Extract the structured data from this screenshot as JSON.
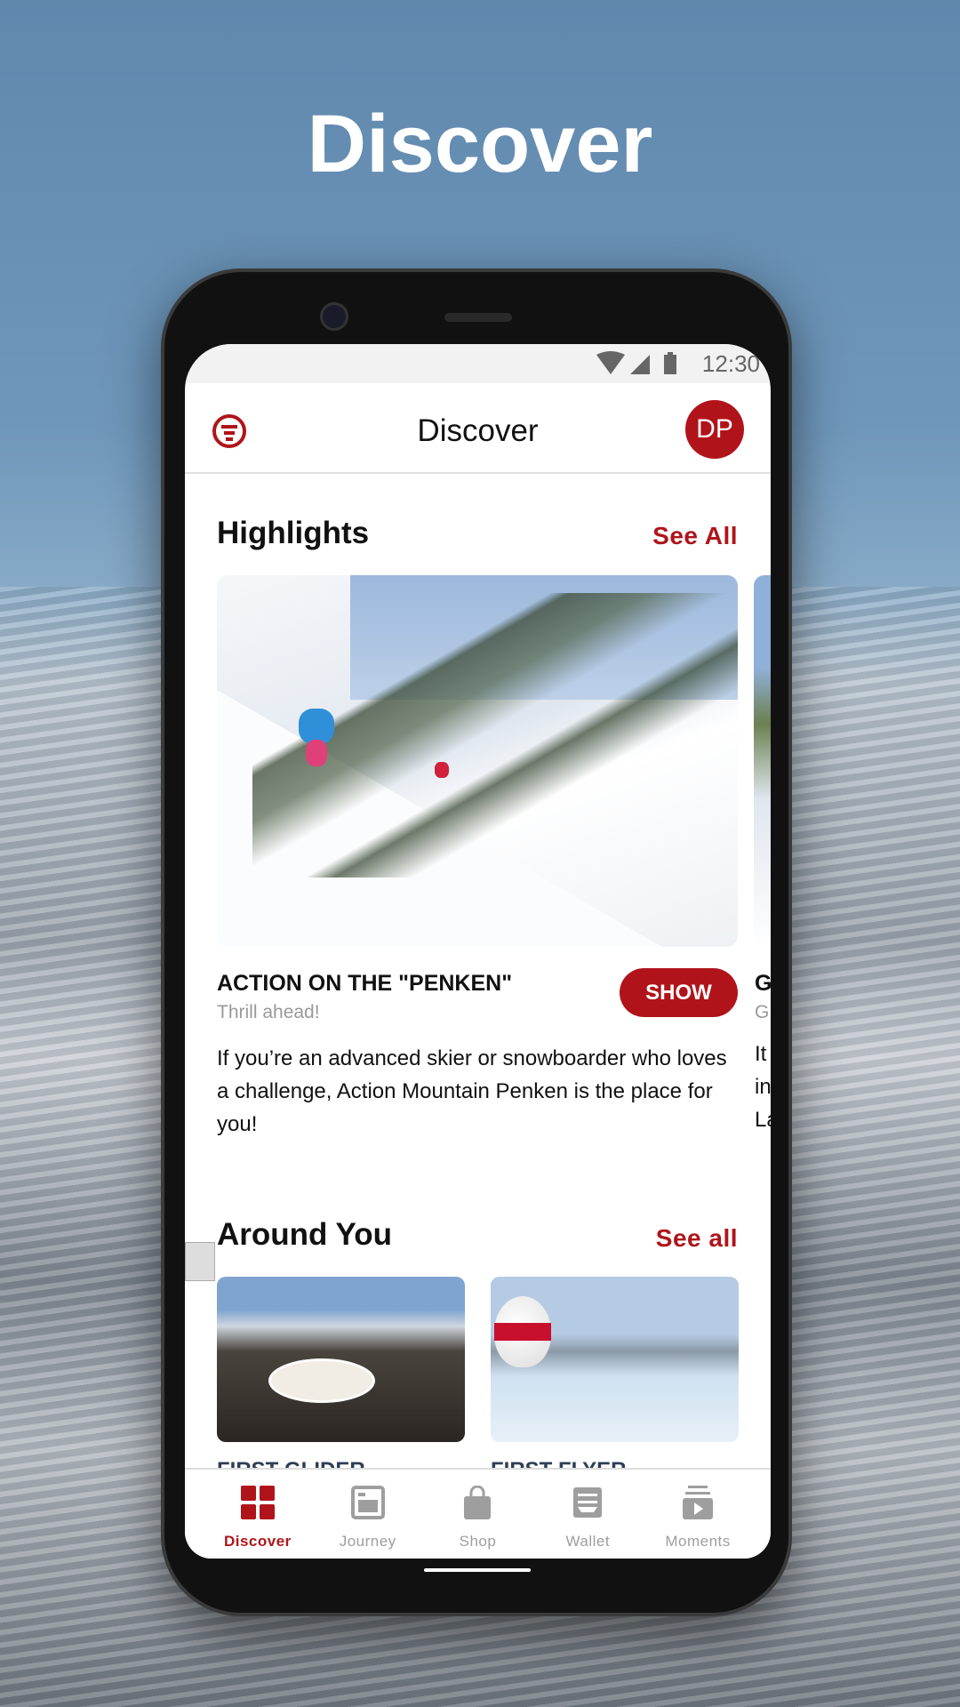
{
  "promo": {
    "title": "Discover"
  },
  "status": {
    "time": "12:30"
  },
  "appbar": {
    "title": "Discover",
    "avatar_initials": "DP"
  },
  "highlights": {
    "title": "Highlights",
    "see_all": "See All",
    "card": {
      "title": "ACTION ON THE \"PENKEN\"",
      "subtitle": "Thrill ahead!",
      "description": "If you’re an advanced skier or snowboarder who loves a challenge, Action Mountain Penken is the place for you!",
      "button": "SHOW"
    },
    "peek_card": {
      "title": "G",
      "subtitle": "G",
      "lines": [
        "It",
        "in",
        "La"
      ]
    }
  },
  "around": {
    "title": "Around You",
    "see_all": "See all",
    "items": [
      {
        "title": "FIRST GLIDER"
      },
      {
        "title": "FIRST FLYER"
      }
    ]
  },
  "nav": {
    "items": [
      {
        "label": "Discover",
        "icon": "grid-icon",
        "active": true
      },
      {
        "label": "Journey",
        "icon": "journey-icon"
      },
      {
        "label": "Shop",
        "icon": "shopping-bag-icon"
      },
      {
        "label": "Wallet",
        "icon": "wallet-icon"
      },
      {
        "label": "Moments",
        "icon": "moments-icon"
      }
    ]
  },
  "colors": {
    "accent": "#b0141a",
    "inactive": "#9e9e9e"
  }
}
